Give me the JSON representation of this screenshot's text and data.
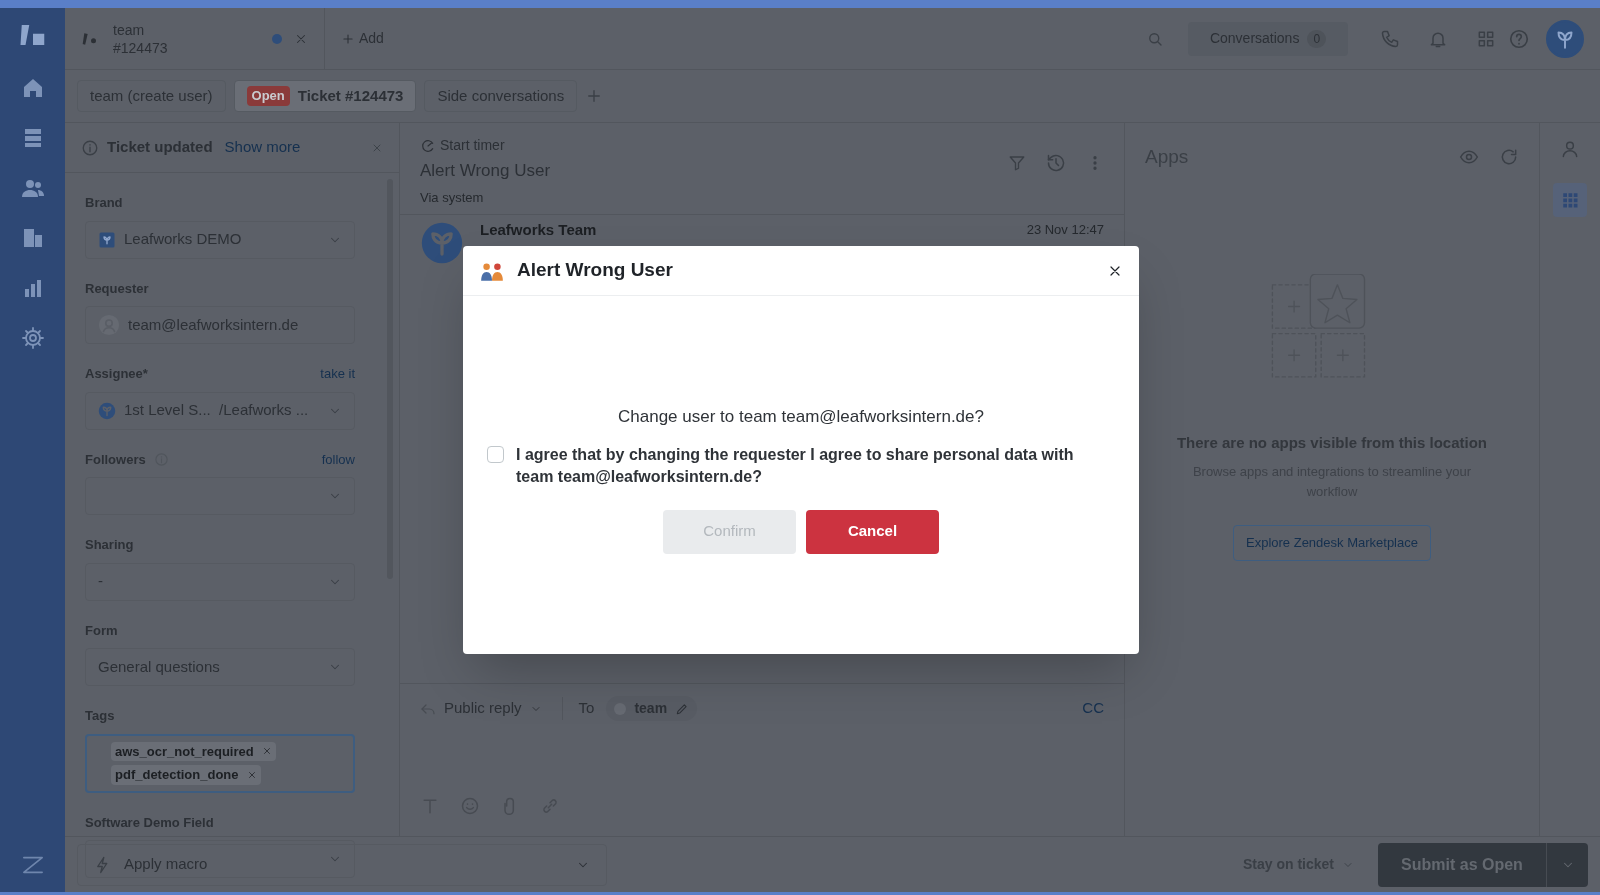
{
  "top_tab": {
    "title": "team",
    "subtitle": "#124473",
    "unread": true
  },
  "add_button": "Add",
  "conversations": {
    "label": "Conversations",
    "count": "0"
  },
  "ticket_tabs": [
    {
      "label": "team (create user)",
      "selected": false
    },
    {
      "label": "Ticket #124473",
      "badge": "Open",
      "selected": true
    },
    {
      "label": "Side conversations",
      "selected": false
    }
  ],
  "notice": {
    "title": "Ticket updated",
    "link": "Show more"
  },
  "fields": [
    {
      "kind": "brand",
      "label": "Brand",
      "value": "Leafworks DEMO"
    },
    {
      "kind": "person",
      "label": "Requester",
      "value": "team@leafworksintern.de"
    },
    {
      "kind": "assignee",
      "label": "Assignee*",
      "action": "take it",
      "value": "1st Level S...  /Leafworks ..."
    },
    {
      "kind": "followers",
      "label": "Followers",
      "action": "follow"
    },
    {
      "kind": "select",
      "label": "Sharing",
      "value": "-"
    },
    {
      "kind": "select",
      "label": "Form",
      "value": "General questions"
    },
    {
      "kind": "tags",
      "label": "Tags",
      "tags": [
        "aws_ocr_not_required",
        "pdf_detection_done"
      ]
    },
    {
      "kind": "select",
      "label": "Software Demo Field"
    }
  ],
  "conversation": {
    "timer": "Start timer",
    "subject": "Alert Wrong User",
    "via": "Via system",
    "author": "Leafworks Team",
    "time": "23 Nov 12:47"
  },
  "reply": {
    "mode": "Public reply",
    "to_label": "To",
    "recipient": "team",
    "cc": "CC"
  },
  "apps": {
    "title": "Apps",
    "empty_title": "There are no apps visible from this location",
    "empty_text": "Browse apps and integrations to streamline your workflow",
    "button": "Explore Zendesk Marketplace"
  },
  "footer": {
    "macro": "Apply macro",
    "after_submit": "Stay on ticket",
    "submit": "Submit as Open"
  },
  "modal": {
    "title": "Alert Wrong User",
    "question": "Change user to team team@leafworksintern.de?",
    "consent": {
      "label": "I agree that by changing the requester I agree to share personal data with team team@leafworksintern.de?",
      "checked": false
    },
    "confirm": {
      "label": "Confirm",
      "disabled": true
    },
    "cancel": "Cancel"
  }
}
